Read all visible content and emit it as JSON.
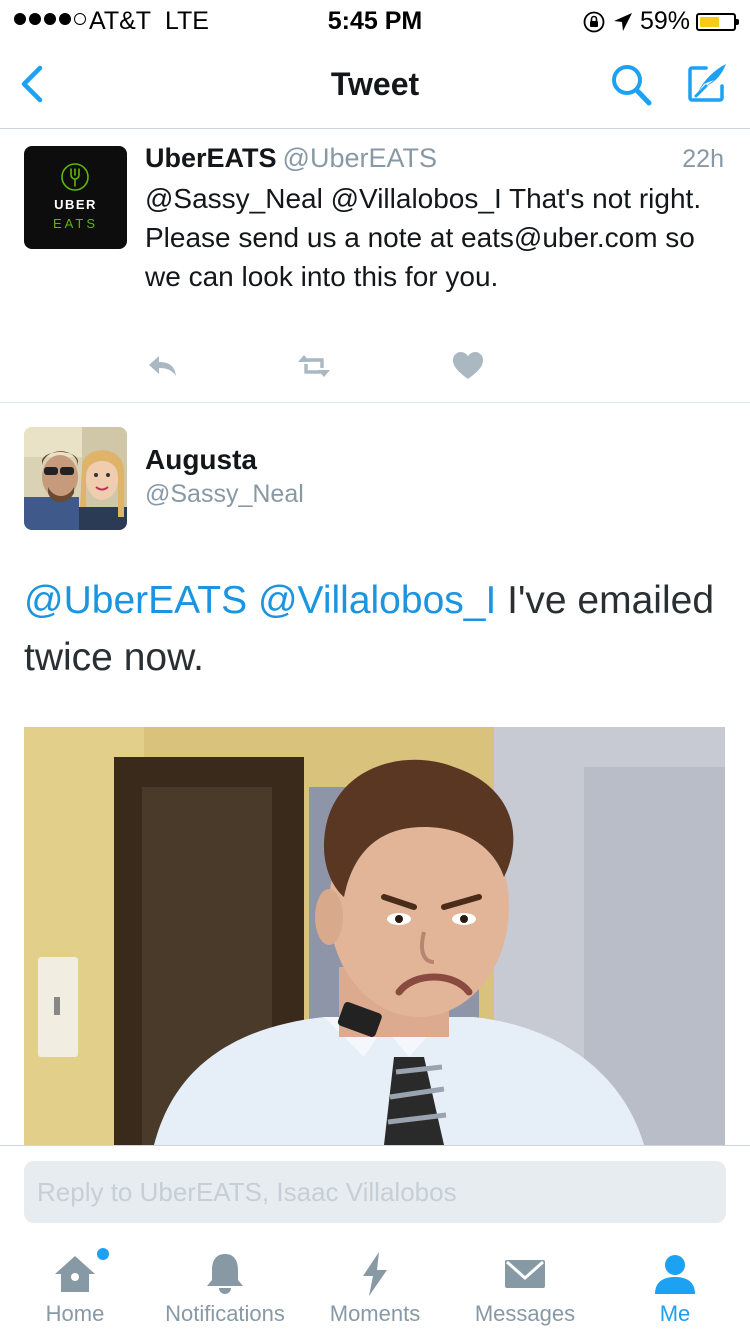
{
  "status_bar": {
    "carrier": "AT&T",
    "network": "LTE",
    "time": "5:45 PM",
    "battery_percent": "59%",
    "battery_level": 0.59,
    "signal_bars": 4
  },
  "nav": {
    "title": "Tweet",
    "back_icon": "chevron-left-icon",
    "search_icon": "search-icon",
    "compose_icon": "compose-icon"
  },
  "tweet1": {
    "name": "UberEATS",
    "handle": "@UberEATS",
    "time": "22h",
    "text": "@Sassy_Neal @Villalobos_I That's not right. Please send us a note at eats@uber.com so we can look into this for you.",
    "avatar_text_top": "UBER",
    "avatar_text_bottom": "EATS"
  },
  "tweet2": {
    "name": "Augusta",
    "handle": "@Sassy_Neal",
    "mention1": "@UberEATS",
    "mention2": "@Villalobos_I",
    "text_rest": "I've emailed twice now."
  },
  "reply": {
    "placeholder": "Reply to UberEATS, Isaac Villalobos"
  },
  "tabs": [
    {
      "label": "Home",
      "icon": "home-icon"
    },
    {
      "label": "Notifications",
      "icon": "bell-icon"
    },
    {
      "label": "Moments",
      "icon": "lightning-icon"
    },
    {
      "label": "Messages",
      "icon": "envelope-icon"
    },
    {
      "label": "Me",
      "icon": "person-icon"
    }
  ],
  "colors": {
    "accent": "#1da1f2",
    "mention": "#1b95e0",
    "secondary_text": "#8899a6",
    "battery": "#f5cc17",
    "uber_green": "#5fb709"
  }
}
